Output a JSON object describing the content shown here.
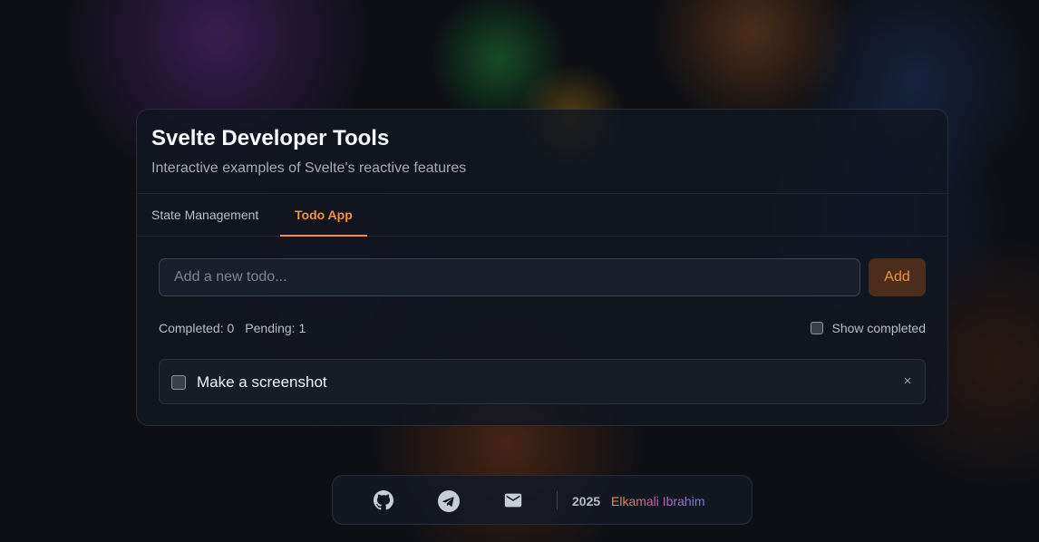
{
  "header": {
    "title": "Svelte Developer Tools",
    "subtitle": "Interactive examples of Svelte's reactive features"
  },
  "tabs": [
    {
      "label": "State Management",
      "active": false
    },
    {
      "label": "Todo App",
      "active": true
    }
  ],
  "todo": {
    "input_placeholder": "Add a new todo...",
    "input_value": "",
    "add_label": "Add",
    "completed_label": "Completed: 0",
    "pending_label": "Pending: 1",
    "show_completed_label": "Show completed",
    "show_completed_checked": false,
    "items": [
      {
        "text": "Make a screenshot",
        "done": false,
        "delete_label": "×"
      }
    ]
  },
  "footer": {
    "icons": [
      "github-icon",
      "telegram-icon",
      "mail-icon"
    ],
    "year": "2025",
    "author": "Elkamali Ibrahim"
  },
  "colors": {
    "accent": "#f0923a",
    "background": "#0d0f14",
    "card": "#111621"
  }
}
